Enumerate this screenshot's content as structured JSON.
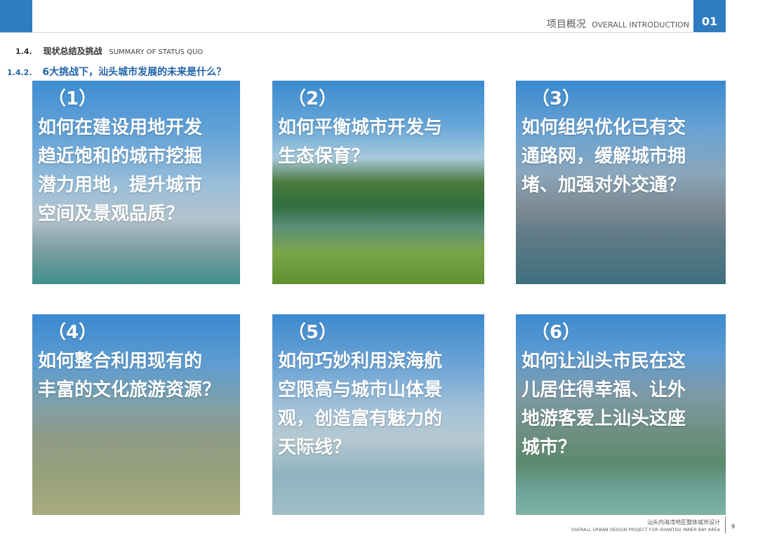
{
  "header": {
    "title_cn": "项目概况",
    "title_en": "OVERALL INTRODUCTION",
    "chapter_number": "01"
  },
  "section": {
    "number": "1.4.",
    "title_cn": "现状总结及挑战",
    "title_en": "SUMMARY OF STATUS QUO"
  },
  "subsection": {
    "number": "1.4.2.",
    "title": "6大挑战下，汕头城市发展的未来是什么？"
  },
  "challenges": [
    {
      "index": "（1）",
      "lines": [
        "如何在建设用地开发",
        "趋近饱和的城市挖掘",
        "潜力用地，提升城市",
        "空间及景观品质？"
      ]
    },
    {
      "index": "（2）",
      "lines": [
        "如何平衡城市开发与",
        "生态保育？"
      ]
    },
    {
      "index": "（3）",
      "lines": [
        "如何组织优化已有交",
        "通路网，缓解城市拥",
        "堵、加强对外交通？"
      ]
    },
    {
      "index": "（4）",
      "lines": [
        "如何整合利用现有的",
        "丰富的文化旅游资源？"
      ]
    },
    {
      "index": "（5）",
      "lines": [
        "如何巧妙利用滨海航",
        "空限高与城市山体景",
        "观，创造富有魅力的",
        "天际线？"
      ]
    },
    {
      "index": "（6）",
      "lines": [
        "如何让汕头市民在这",
        "儿居住得幸福、让外",
        "地游客爱上汕头这座",
        "城市？"
      ]
    }
  ],
  "footer": {
    "project_cn": "汕头内海湾地区整体城市设计",
    "project_en": "OVERALL URBAN DESIGN PROJECT FOR SHANTOU INNER BAY AREA",
    "page_number": "9"
  },
  "colors": {
    "accent_blue": "#2f7cc1",
    "subsection_blue": "#1f63a8",
    "card_text": "#ffffff"
  }
}
